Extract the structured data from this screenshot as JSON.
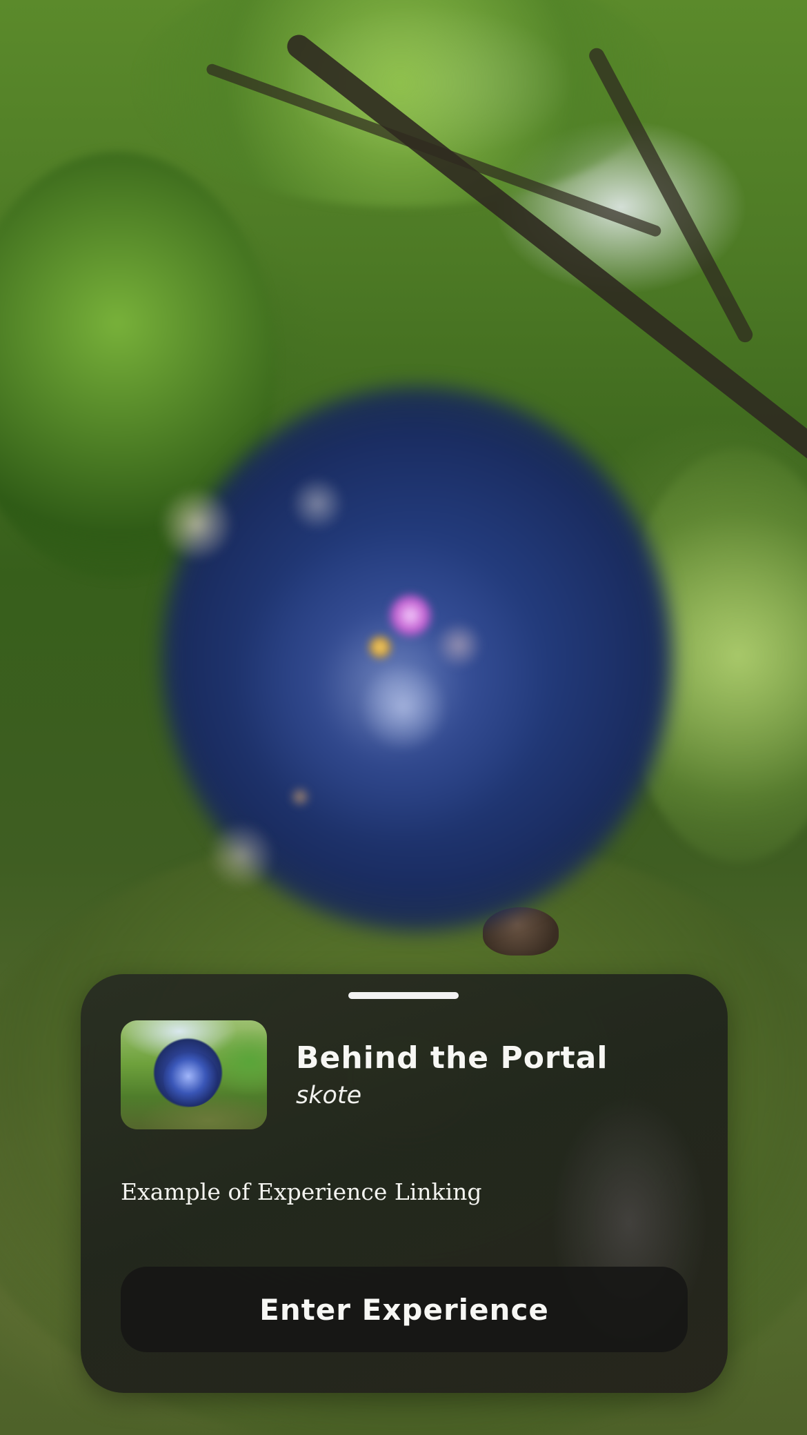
{
  "experience": {
    "title": "Behind the Portal",
    "author": "skote",
    "description": "Example of Experience Linking",
    "enter_button_label": "Enter Experience"
  },
  "colors": {
    "card_background": "#24271f",
    "button_background": "#161614",
    "text_primary": "#f7f7f4",
    "portal_blue": "#223a7a"
  },
  "icons": {
    "grab_handle": "sheet-grab-handle",
    "thumbnail": "experience-thumbnail-image"
  }
}
